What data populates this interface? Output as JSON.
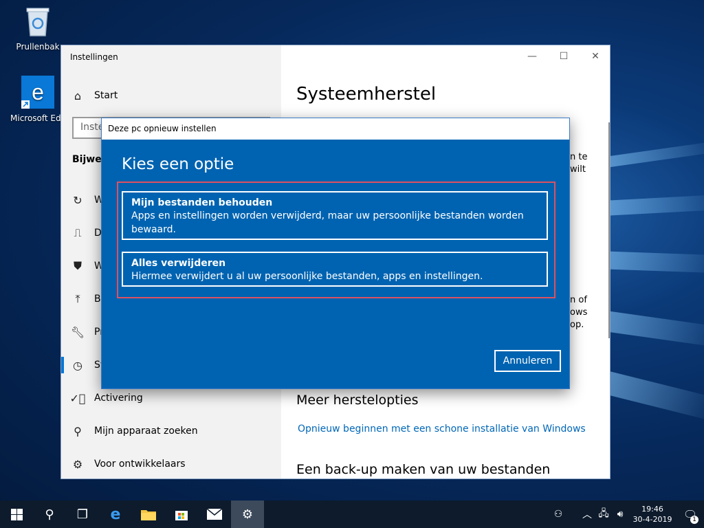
{
  "desktop": {
    "icons": [
      {
        "label": "Prullenbak",
        "icon": "recycle-bin-icon"
      },
      {
        "label": "Microsoft Edge",
        "icon": "edge-icon"
      }
    ]
  },
  "settings": {
    "window_title": "Instellingen",
    "search_placeholder": "Instel",
    "section_label": "Bijwerk",
    "nav": [
      {
        "label": "Start",
        "icon": "home-icon"
      },
      {
        "label": "W",
        "icon": "sync-icon"
      },
      {
        "label": "De",
        "icon": "delivery-icon"
      },
      {
        "label": "W",
        "icon": "shield-icon"
      },
      {
        "label": "Ba",
        "icon": "backup-icon"
      },
      {
        "label": "Pr",
        "icon": "wrench-icon"
      },
      {
        "label": "Sy",
        "icon": "history-icon"
      },
      {
        "label": "Activering",
        "icon": "check-circle-icon"
      },
      {
        "label": "Mijn apparaat zoeken",
        "icon": "person-pin-icon"
      },
      {
        "label": "Voor ontwikkelaars",
        "icon": "developer-icon"
      }
    ],
    "content": {
      "title": "Systeemherstel",
      "edge_text_1": [
        "n te",
        "wilt"
      ],
      "edge_text_2": [
        "n of",
        "ows",
        "op."
      ],
      "more_options": "Meer herstelopties",
      "fresh_start_link": "Opnieuw beginnen met een schone installatie van Windows",
      "backup_heading": "Een back-up maken van uw bestanden"
    }
  },
  "dialog": {
    "title": "Deze pc opnieuw instellen",
    "heading": "Kies een optie",
    "options": [
      {
        "title": "Mijn bestanden behouden",
        "description": "Apps en instellingen worden verwijderd, maar uw persoonlijke bestanden worden bewaard."
      },
      {
        "title": "Alles verwijderen",
        "description": "Hiermee verwijdert u al uw persoonlijke bestanden, apps en instellingen."
      }
    ],
    "cancel_label": "Annuleren"
  },
  "taskbar": {
    "time": "19:46",
    "date": "30-4-2019",
    "notification_count": "1"
  },
  "colors": {
    "dialog_bg": "#0063b1",
    "accent": "#0078d7",
    "link": "#0067b8",
    "highlight_border": "#e05060"
  }
}
